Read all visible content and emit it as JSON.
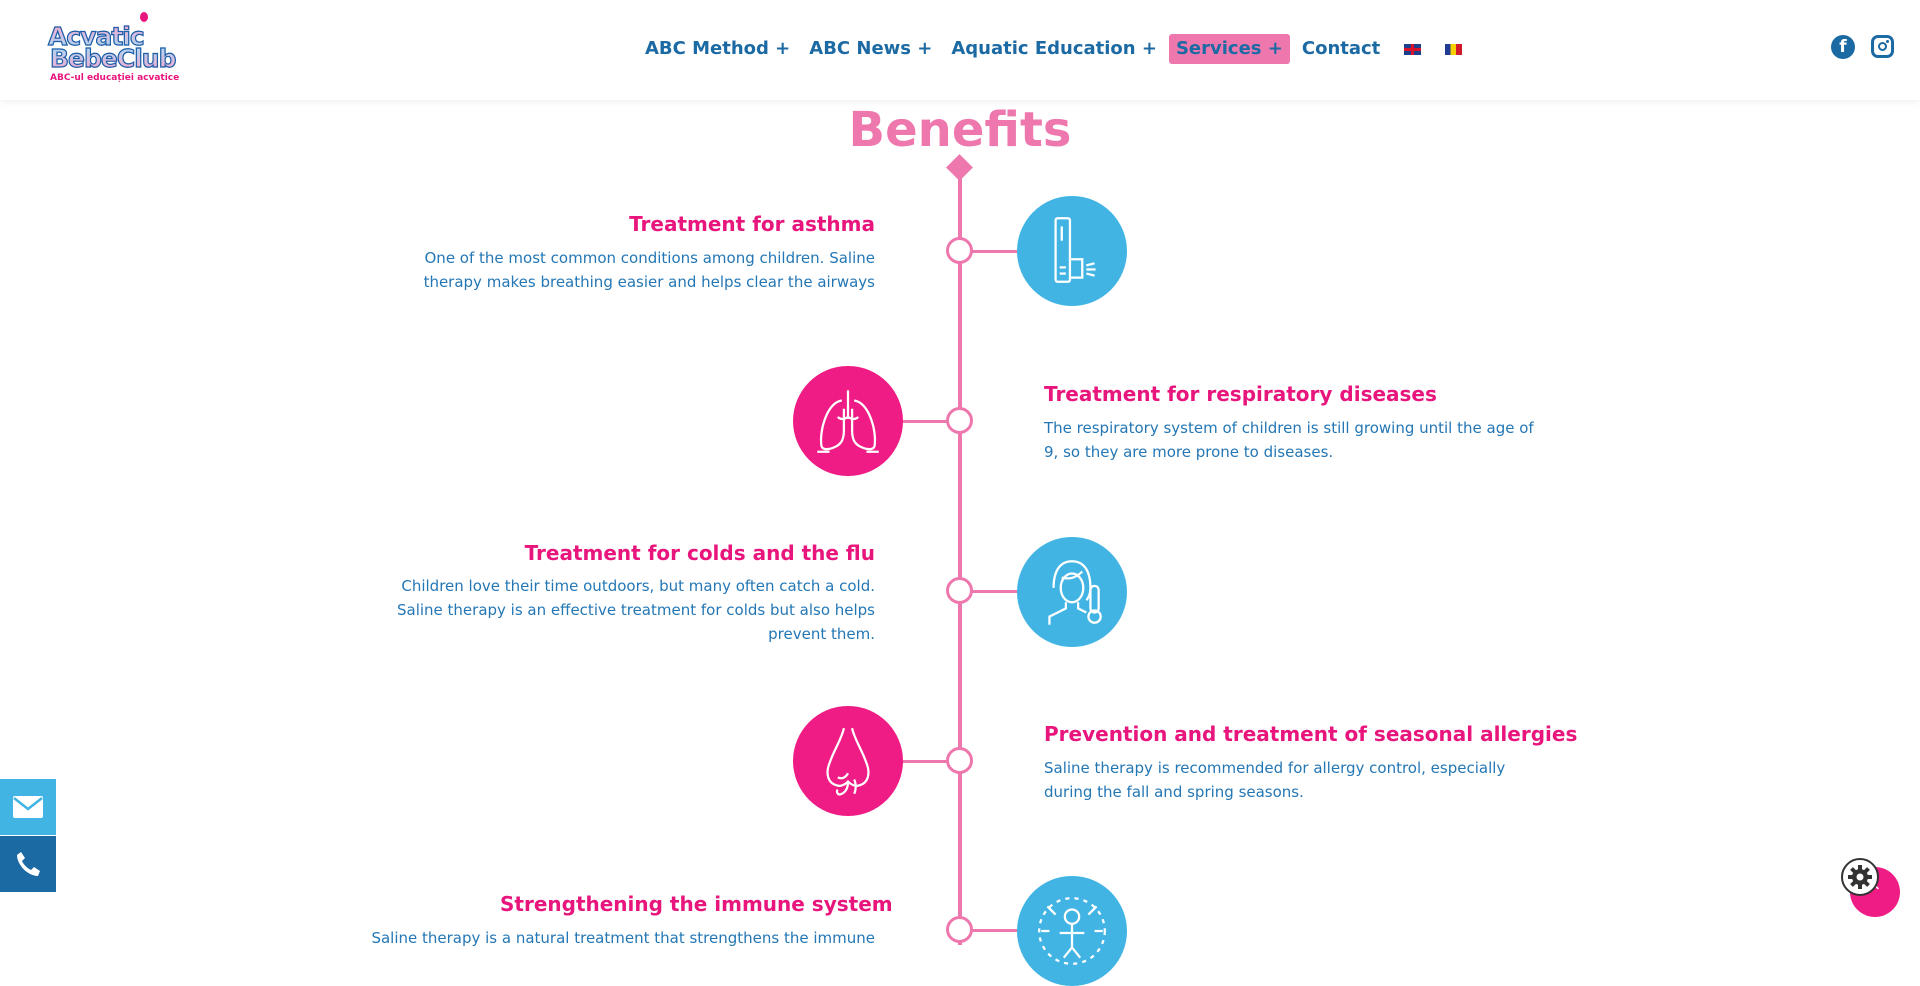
{
  "header": {
    "logo": {
      "line1": "Acvatic",
      "line2": "BebeClub",
      "tagline": "ABC-ul educației acvatice"
    },
    "nav": [
      {
        "label": "ABC Method +",
        "active": false
      },
      {
        "label": "ABC News +",
        "active": false
      },
      {
        "label": "Aquatic Education +",
        "active": false
      },
      {
        "label": "Services +",
        "active": true
      },
      {
        "label": "Contact",
        "active": false
      }
    ],
    "languages": [
      "english-flag",
      "romanian-flag"
    ],
    "social": [
      "facebook-icon",
      "instagram-icon"
    ]
  },
  "section": {
    "title": "Benefits"
  },
  "benefits": [
    {
      "title": "Treatment for asthma",
      "text": "One of the most common conditions among children. Saline therapy makes breathing easier and helps clear the airways",
      "icon": "inhaler-icon",
      "side": "left"
    },
    {
      "title": "Treatment for respiratory diseases",
      "text": "The respiratory system of children is still growing until the age of 9, so they are more prone to diseases.",
      "icon": "lungs-icon",
      "side": "right"
    },
    {
      "title": "Treatment for colds and the flu",
      "text": "Children love their time outdoors, but many often catch a cold. Saline therapy is an effective treatment for colds but also helps prevent them.",
      "icon": "thermometer-person-icon",
      "side": "left"
    },
    {
      "title": "Prevention and treatment of seasonal allergies",
      "text": "Saline therapy is recommended for allergy control, especially during the fall and spring seasons.",
      "icon": "nose-icon",
      "side": "right"
    },
    {
      "title": "Strengthening the immune system",
      "text": "Saline therapy is a natural treatment that strengthens the immune",
      "icon": "immune-person-icon",
      "side": "left"
    }
  ],
  "widgets": [
    "mail-icon",
    "phone-icon",
    "gear-icon",
    "scroll-top-icon"
  ],
  "colors": {
    "pink": "#ee78ae",
    "magenta": "#e8157d",
    "blue": "#1c6aa3",
    "light_blue": "#41b4e4"
  }
}
